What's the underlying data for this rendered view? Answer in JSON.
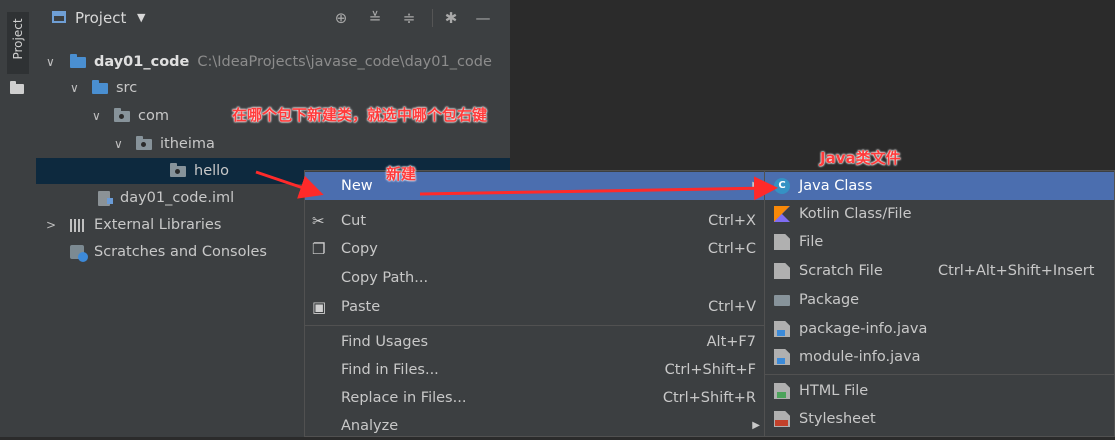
{
  "window": {
    "background": "#2b2b2b"
  },
  "sidebar_strip": {
    "tab_label": "Project"
  },
  "panel": {
    "title": "Project",
    "toolbar_icons": [
      "target-icon",
      "expand-all-icon",
      "collapse-all-icon",
      "gear-icon",
      "minimize-icon"
    ]
  },
  "tree": {
    "root_name": "day01_code",
    "root_path": "C:\\IdeaProjects\\javase_code\\day01_code",
    "src": "src",
    "com": "com",
    "itheima": "itheima",
    "hello": "hello",
    "iml": "day01_code.iml",
    "external_libraries": "External Libraries",
    "scratches": "Scratches and Consoles"
  },
  "context_menu": {
    "new": "New",
    "cut": "Cut",
    "cut_shortcut": "Ctrl+X",
    "copy": "Copy",
    "copy_shortcut": "Ctrl+C",
    "copy_path": "Copy Path...",
    "paste": "Paste",
    "paste_shortcut": "Ctrl+V",
    "find_usages": "Find Usages",
    "find_usages_shortcut": "Alt+F7",
    "find_in_files": "Find in Files...",
    "find_in_files_shortcut": "Ctrl+Shift+F",
    "replace_in_files": "Replace in Files...",
    "replace_in_files_shortcut": "Ctrl+Shift+R",
    "analyze": "Analyze"
  },
  "submenu": {
    "java_class": "Java Class",
    "kotlin": "Kotlin Class/File",
    "file": "File",
    "scratch_file": "Scratch File",
    "scratch_shortcut": "Ctrl+Alt+Shift+Insert",
    "package": "Package",
    "package_info": "package-info.java",
    "module_info": "module-info.java",
    "html_file": "HTML File",
    "stylesheet": "Stylesheet"
  },
  "annotations": {
    "right_click_hint": "在哪个包下新建类，就选中哪个包右键",
    "new_hint": "新建",
    "java_file_hint": "Java类文件",
    "color": "#ff3b3b"
  }
}
